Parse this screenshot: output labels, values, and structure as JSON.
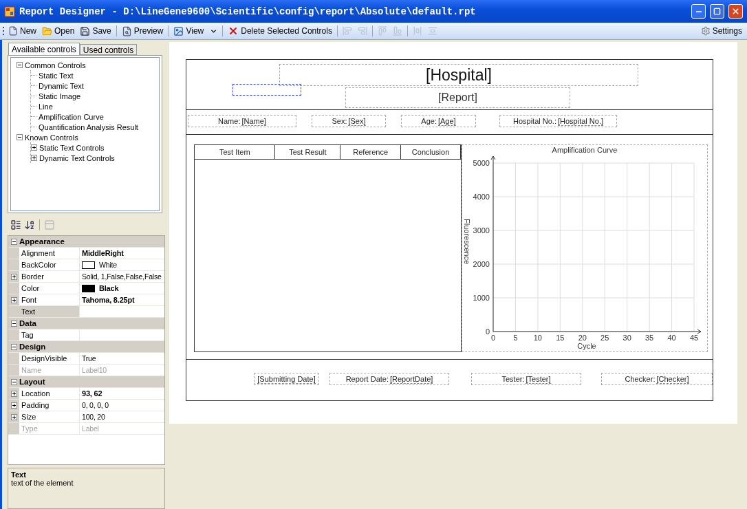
{
  "window": {
    "title": "Report Designer - D:\\LineGene9600\\Scientific\\config\\report\\Absolute\\default.rpt"
  },
  "toolbar": {
    "items": [
      {
        "kind": "button",
        "label": "New"
      },
      {
        "kind": "button",
        "label": "Open"
      },
      {
        "kind": "button",
        "label": "Save"
      },
      {
        "kind": "button",
        "label": "Preview"
      },
      {
        "kind": "dropdown",
        "label": "View"
      },
      {
        "kind": "button",
        "label": "Delete Selected Controls"
      }
    ],
    "settings": "Settings"
  },
  "tabs": [
    {
      "label": "Available controls",
      "selected": true
    },
    {
      "label": "Used controls",
      "selected": false
    }
  ],
  "tree": [
    {
      "label": "Common Controls",
      "expanded": true,
      "children": [
        {
          "label": "Static Text"
        },
        {
          "label": "Dynamic Text"
        },
        {
          "label": "Static Image"
        },
        {
          "label": "Line"
        },
        {
          "label": "Amplification Curve"
        },
        {
          "label": "Quantification Analysis  Result"
        }
      ]
    },
    {
      "label": "Known Controls",
      "expanded": true,
      "children": [
        {
          "label": "Static Text Controls",
          "expanded": false
        },
        {
          "label": "Dynamic Text Controls",
          "expanded": false
        }
      ]
    }
  ],
  "properties": [
    {
      "name": "Appearance",
      "expanded": true,
      "rows": [
        {
          "name": "Alignment",
          "value": "MiddleRight",
          "bold": true,
          "selected": false,
          "disabled": false
        },
        {
          "name": "BackColor",
          "value": "White",
          "color": "#ffffff",
          "bold": false,
          "selected": false,
          "disabled": false
        },
        {
          "name": "Border",
          "value": "Solid, 1,False,False,False",
          "expanded": false,
          "bold": false,
          "selected": false,
          "disabled": false
        },
        {
          "name": "Color",
          "value": "Black",
          "color": "#000000",
          "bold": true,
          "selected": false,
          "disabled": false
        },
        {
          "name": "Font",
          "value": "Tahoma, 8.25pt",
          "expanded": false,
          "bold": true,
          "selected": false,
          "disabled": false
        },
        {
          "name": "Text",
          "selected": true,
          "disabled": false
        }
      ]
    },
    {
      "name": "Data",
      "expanded": true,
      "rows": [
        {
          "name": "Tag",
          "selected": false,
          "disabled": false
        }
      ]
    },
    {
      "name": "Design",
      "expanded": true,
      "rows": [
        {
          "name": "DesignVisible",
          "value": "True",
          "bold": false,
          "selected": false,
          "disabled": false
        },
        {
          "name": "Name",
          "value": "Label10",
          "bold": false,
          "selected": false,
          "disabled": true
        }
      ]
    },
    {
      "name": "Layout",
      "expanded": true,
      "rows": [
        {
          "name": "Location",
          "value": "93, 62",
          "expanded": false,
          "bold": true,
          "selected": false,
          "disabled": false
        },
        {
          "name": "Padding",
          "value": "0, 0, 0, 0",
          "expanded": false,
          "bold": false,
          "selected": false,
          "disabled": false
        },
        {
          "name": "Size",
          "value": "100, 20",
          "expanded": false,
          "bold": false,
          "selected": false,
          "disabled": false
        },
        {
          "name": "Type",
          "value": "Label",
          "bold": false,
          "selected": false,
          "disabled": true
        }
      ]
    }
  ],
  "description": {
    "title": "Text",
    "text": "text of the element"
  },
  "report": {
    "hospital": "[Hospital]",
    "report_title": "[Report]",
    "patient_fields": [
      {
        "label": "Name:",
        "value": "[Name]"
      },
      {
        "label": "Sex:",
        "value": "[Sex]"
      },
      {
        "label": "Age:",
        "value": "[Age]"
      },
      {
        "label": "Hospital No.:",
        "value": "[Hospital No.]"
      }
    ],
    "table": {
      "columns": [
        "Test Item",
        "Test Result",
        "Reference",
        "Conclusion"
      ]
    },
    "chart": {
      "chart_data": {
        "type": "line",
        "grid": true,
        "title": "Amplification Curve",
        "xlabel": "Cycle",
        "ylabel": "Fluorescence",
        "xlim": [
          0,
          45
        ],
        "ylim": [
          0,
          5000
        ],
        "xticks": [
          0,
          5,
          10,
          15,
          20,
          25,
          30,
          35,
          40,
          45
        ],
        "yticks": [
          0,
          1000,
          2000,
          3000,
          4000,
          5000
        ]
      }
    },
    "footer_fields": [
      {
        "value": "[Submitting Date]"
      },
      {
        "label": "Report Date:",
        "value": "[ReportDate]"
      },
      {
        "label": "Tester:",
        "value": "[Tester]"
      },
      {
        "label": "Checker:",
        "value": "[Checker]"
      }
    ]
  }
}
